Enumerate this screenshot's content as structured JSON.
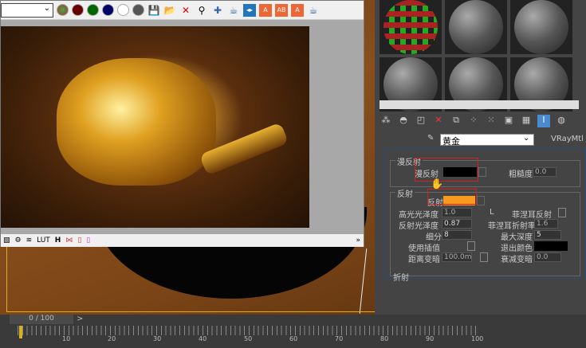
{
  "vfb": {
    "bottom_tools": [
      "LUT",
      "H"
    ]
  },
  "material": {
    "name": "黄金",
    "type": "VRayMtl"
  },
  "diffuse": {
    "group": "漫反射",
    "label": "漫反射",
    "roughness_label": "粗糙度",
    "roughness": "0.0",
    "color": "#000000"
  },
  "reflection": {
    "group": "反射",
    "label": "反射",
    "color": "#f89a20",
    "hilight_label": "高光光泽度",
    "hilight": "1.0",
    "l_btn": "L",
    "gloss_label": "反射光泽度",
    "gloss": "0.87",
    "subdivs_label": "细分",
    "subdivs": "8",
    "interp_label": "使用插值",
    "dim_label": "距离变暗",
    "dim": "100.0m",
    "fresnel_label": "菲涅耳反射",
    "fresnel_ior_label": "菲涅耳折射率",
    "fresnel_ior": "1.6",
    "depth_label": "最大深度",
    "depth": "5",
    "exit_label": "退出颜色",
    "falloff_label": "衰减变暗",
    "falloff": "0.0"
  },
  "next_group": "折射",
  "timeline": {
    "frame": "0 / 100",
    "ticks": [
      "10",
      "20",
      "30",
      "40",
      "50",
      "60",
      "70",
      "80",
      "90",
      "100"
    ]
  }
}
